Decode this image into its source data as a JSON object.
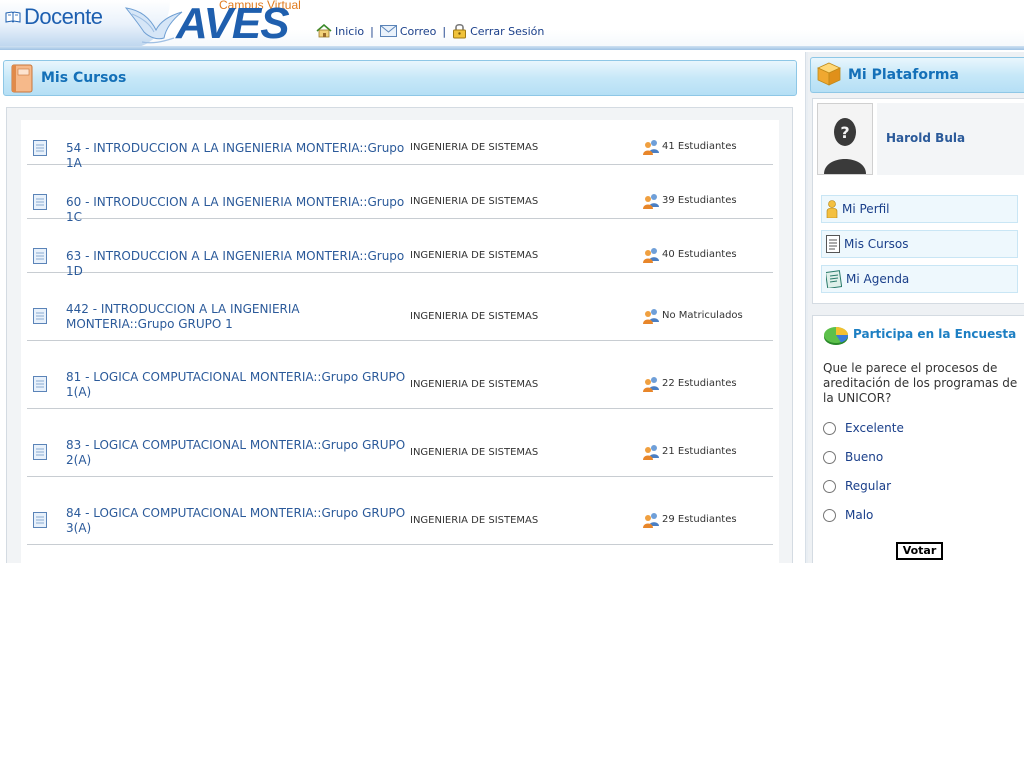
{
  "header": {
    "brand": "Docente",
    "logo_small": "Campus Virtual",
    "logo_big": "AVES",
    "nav": [
      {
        "label": "Inicio",
        "icon": "home-icon"
      },
      {
        "label": "Correo",
        "icon": "mail-icon"
      },
      {
        "label": "Cerrar Sesión",
        "icon": "lock-icon"
      }
    ],
    "separator": "|"
  },
  "main": {
    "title": "Mis Cursos",
    "courses": [
      {
        "name": "54 - INTRODUCCION A LA INGENIERIA MONTERIA::Grupo 1A",
        "career": "INGENIERIA DE SISTEMAS",
        "students": "41 Estudiantes"
      },
      {
        "name": "60 - INTRODUCCION A LA INGENIERIA MONTERIA::Grupo 1C",
        "career": "INGENIERIA DE SISTEMAS",
        "students": "39 Estudiantes"
      },
      {
        "name": "63 - INTRODUCCION A LA INGENIERIA MONTERIA::Grupo 1D",
        "career": "INGENIERIA DE SISTEMAS",
        "students": "40 Estudiantes"
      },
      {
        "name": "442 - INTRODUCCION A LA INGENIERIA MONTERIA::Grupo GRUPO 1",
        "career": "INGENIERIA DE SISTEMAS",
        "students": "No Matriculados"
      },
      {
        "name": "81 - LOGICA COMPUTACIONAL MONTERIA::Grupo GRUPO 1(A)",
        "career": "INGENIERIA DE SISTEMAS",
        "students": "22 Estudiantes"
      },
      {
        "name": "83 - LOGICA COMPUTACIONAL MONTERIA::Grupo GRUPO 2(A)",
        "career": "INGENIERIA DE SISTEMAS",
        "students": "21 Estudiantes"
      },
      {
        "name": "84 - LOGICA COMPUTACIONAL MONTERIA::Grupo GRUPO 3(A)",
        "career": "INGENIERIA DE SISTEMAS",
        "students": "29 Estudiantes"
      }
    ]
  },
  "sidebar": {
    "title": "Mi Plataforma",
    "user_name": "Harold Bula",
    "menu": [
      {
        "label": "Mi Perfil",
        "icon": "person-icon"
      },
      {
        "label": "Mis Cursos",
        "icon": "document-list-icon"
      },
      {
        "label": "Mi Agenda",
        "icon": "agenda-icon"
      }
    ],
    "poll": {
      "title": "Participa en la Encuesta",
      "question": "Que le parece el procesos de areditación de los programas de la UNICOR?",
      "options": [
        "Excelente",
        "Bueno",
        "Regular",
        "Malo"
      ],
      "vote_label": "Votar"
    }
  }
}
